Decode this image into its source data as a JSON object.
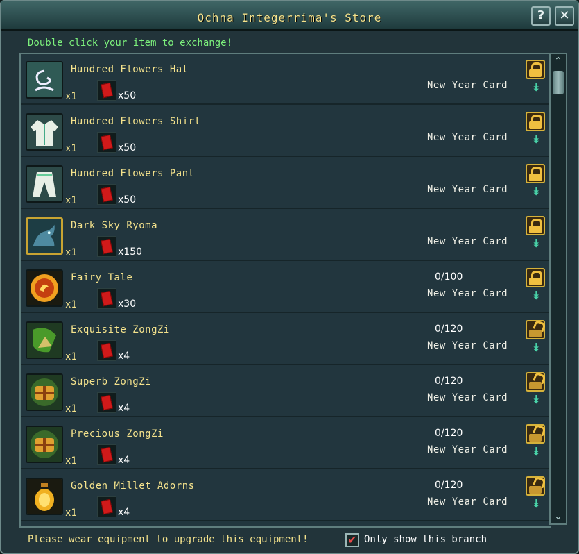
{
  "window": {
    "title": "Ochna Integerrima's Store",
    "help_label": "?",
    "close_label": "✕"
  },
  "instruction": "Double click your item to exchange!",
  "items": [
    {
      "name": "Hundred Flowers Hat",
      "qty": "x1",
      "cost": "x50",
      "limit": "",
      "currency": "New Year Card",
      "lock": "closed",
      "icon": "hat-icon",
      "rare": false
    },
    {
      "name": "Hundred Flowers Shirt",
      "qty": "x1",
      "cost": "x50",
      "limit": "",
      "currency": "New Year Card",
      "lock": "closed",
      "icon": "shirt-icon",
      "rare": false
    },
    {
      "name": "Hundred Flowers Pant",
      "qty": "x1",
      "cost": "x50",
      "limit": "",
      "currency": "New Year Card",
      "lock": "closed",
      "icon": "pants-icon",
      "rare": false
    },
    {
      "name": "Dark Sky Ryoma",
      "qty": "x1",
      "cost": "x150",
      "limit": "",
      "currency": "New Year Card",
      "lock": "closed",
      "icon": "mount-icon",
      "rare": true
    },
    {
      "name": "Fairy Tale",
      "qty": "x1",
      "cost": "x30",
      "limit": "0/100",
      "currency": "New Year Card",
      "lock": "closed",
      "icon": "orb-icon",
      "rare": false
    },
    {
      "name": "Exquisite ZongZi",
      "qty": "x1",
      "cost": "x4",
      "limit": "0/120",
      "currency": "New Year Card",
      "lock": "open",
      "icon": "zongzi-icon",
      "rare": false
    },
    {
      "name": "Superb ZongZi",
      "qty": "x1",
      "cost": "x4",
      "limit": "0/120",
      "currency": "New Year Card",
      "lock": "open",
      "icon": "gift-box-icon",
      "rare": false
    },
    {
      "name": "Precious ZongZi",
      "qty": "x1",
      "cost": "x4",
      "limit": "0/120",
      "currency": "New Year Card",
      "lock": "open",
      "icon": "gift-box-icon",
      "rare": false
    },
    {
      "name": "Golden Millet Adorns",
      "qty": "x1",
      "cost": "x4",
      "limit": "0/120",
      "currency": "New Year Card",
      "lock": "open",
      "icon": "lantern-icon",
      "rare": false
    }
  ],
  "footer": {
    "warning": "Please wear equipment to upgrade this equipment!",
    "checkbox_mark": "✔",
    "checkbox_label": "Only show this branch"
  },
  "colors": {
    "accent_text": "#f4e28c",
    "instruction_text": "#7cf07c",
    "currency_card": "#d01a1a"
  }
}
